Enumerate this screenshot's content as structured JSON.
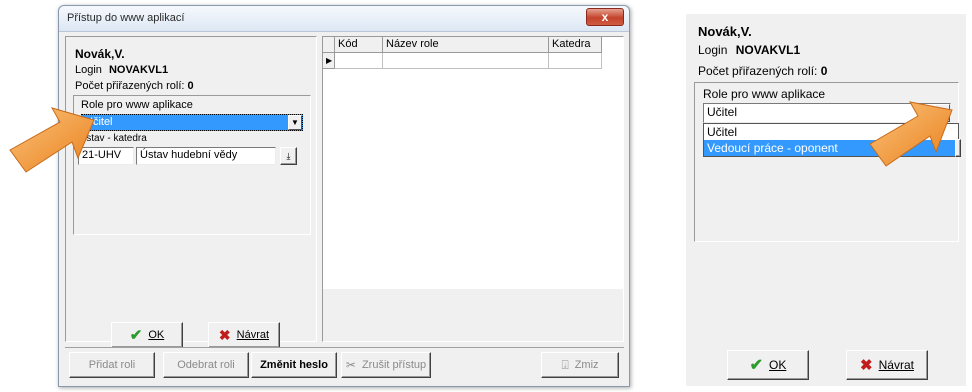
{
  "window": {
    "title": "Přístup do www aplikací",
    "close_label": "x"
  },
  "user": {
    "name": "Novák,V.",
    "login_label": "Login",
    "login_value": "NOVAKVL1",
    "roles_count_label": "Počet přiřazených rolí:",
    "roles_count_value": "0"
  },
  "role_group": {
    "label": "Role pro www aplikace",
    "selected": "Učitel"
  },
  "ustav": {
    "label": "Ústav - katedra",
    "code": "21-UHV",
    "name": "Ústav hudební vědy"
  },
  "grid": {
    "columns": [
      "Kód",
      "Název role",
      "Katedra"
    ]
  },
  "buttons": {
    "ok": "OK",
    "navrat": "Návrat"
  },
  "toolbar": {
    "pridat": "Přidat roli",
    "odebrat": "Odebrat roli",
    "zmenit": "Změnit heslo",
    "zrusit": "Zrušit přístup",
    "zmiz": "Zmiz"
  },
  "right_panel": {
    "name": "Novák,V.",
    "login_label": "Login",
    "login_value": "NOVAKVL1",
    "roles_count_label": "Počet přiřazených rolí:",
    "roles_count_value": "0",
    "group_label": "Role pro www aplikace",
    "selected": "Učitel",
    "options": [
      "Učitel",
      "Vedoucí práce - oponent"
    ],
    "ok": "OK",
    "navrat": "Návrat"
  },
  "colors": {
    "selection": "#3399ff",
    "arrow": "#f49b3c",
    "window_bg": "#f0f0f0"
  }
}
